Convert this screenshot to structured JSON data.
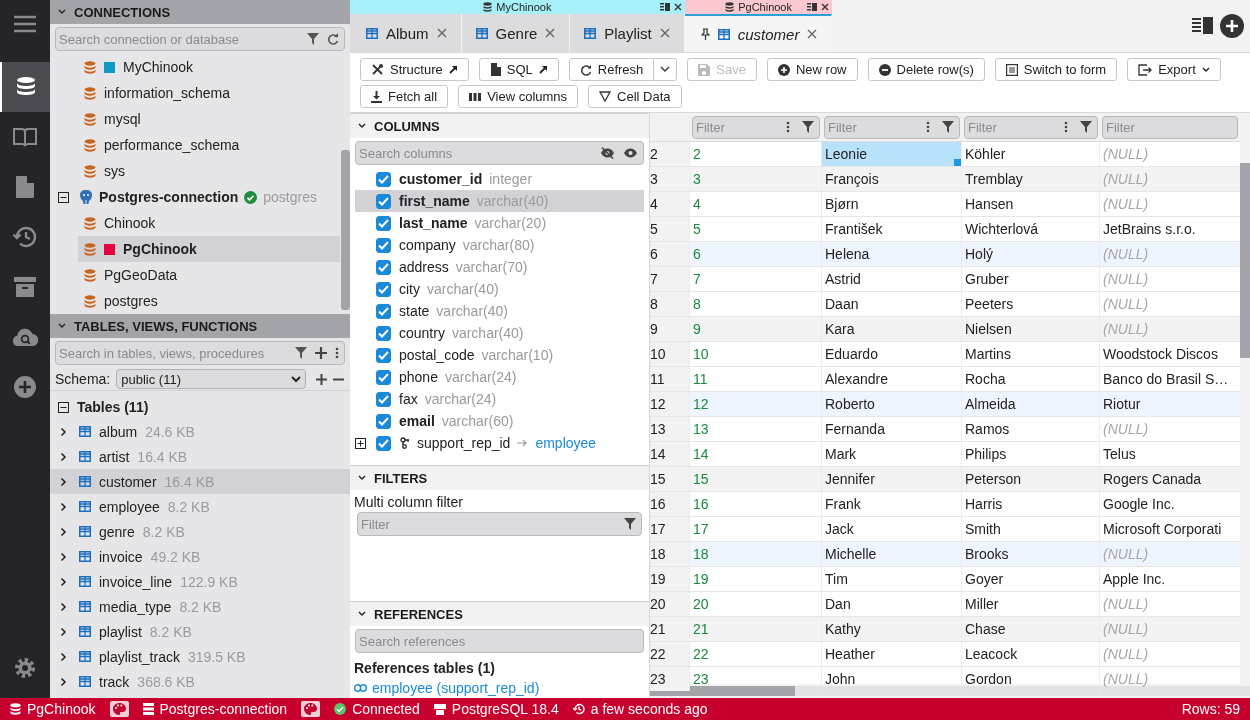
{
  "activity_bar": {
    "items": [
      {
        "selected": true
      },
      {
        "selected": false
      },
      {
        "selected": false
      },
      {
        "selected": false
      },
      {
        "selected": false
      },
      {
        "selected": false
      }
    ]
  },
  "connections": {
    "title": "CONNECTIONS",
    "search": {
      "placeholder": "Search connection or database"
    },
    "items": [
      {
        "kind": "database",
        "name": "MyChinook",
        "color": "#0e98c4",
        "selected": false
      },
      {
        "kind": "database",
        "name": "information_schema",
        "selected": false
      },
      {
        "kind": "database",
        "name": "mysql",
        "selected": false
      },
      {
        "kind": "database",
        "name": "performance_schema",
        "selected": false
      },
      {
        "kind": "database",
        "name": "sys",
        "selected": false
      },
      {
        "kind": "connection",
        "name": "Postgres-connection",
        "connected": true,
        "user": "postgres",
        "expanded": true,
        "children": [
          {
            "kind": "database",
            "name": "Chinook",
            "selected": false
          },
          {
            "kind": "database",
            "name": "PgChinook",
            "color": "#e8003d",
            "selected": true
          },
          {
            "kind": "database",
            "name": "PgGeoData",
            "selected": false
          },
          {
            "kind": "database",
            "name": "postgres",
            "selected": false
          }
        ]
      }
    ]
  },
  "tables_panel": {
    "title": "TABLES, VIEWS, FUNCTIONS",
    "search": {
      "placeholder": "Search in tables, views, procedures"
    },
    "schema_label": "Schema:",
    "schema": "public (11)",
    "group": {
      "label": "Tables (11)",
      "expanded": true,
      "items": [
        {
          "name": "album",
          "size": "24.6 KB",
          "selected": false
        },
        {
          "name": "artist",
          "size": "16.4 KB",
          "selected": false
        },
        {
          "name": "customer",
          "size": "16.4 KB",
          "selected": true
        },
        {
          "name": "employee",
          "size": "8.2 KB",
          "selected": false
        },
        {
          "name": "genre",
          "size": "8.2 KB",
          "selected": false
        },
        {
          "name": "invoice",
          "size": "49.2 KB",
          "selected": false
        },
        {
          "name": "invoice_line",
          "size": "122.9 KB",
          "selected": false
        },
        {
          "name": "media_type",
          "size": "8.2 KB",
          "selected": false
        },
        {
          "name": "playlist",
          "size": "8.2 KB",
          "selected": false
        },
        {
          "name": "playlist_track",
          "size": "319.5 KB",
          "selected": false
        },
        {
          "name": "track",
          "size": "368.6 KB",
          "selected": false
        }
      ]
    }
  },
  "tab_groups": [
    {
      "title": "MyChinook",
      "color": "#a6f0fa",
      "tabs": [
        {
          "label": "Album",
          "selected": false,
          "pinned": false
        },
        {
          "label": "Genre",
          "selected": false,
          "pinned": false
        },
        {
          "label": "Playlist",
          "selected": false,
          "pinned": false
        }
      ]
    },
    {
      "title": "PgChinook",
      "color": "#fcc8d0",
      "tabs": [
        {
          "label": "customer",
          "selected": true,
          "pinned": true
        }
      ]
    }
  ],
  "toolbar": {
    "rows": [
      [
        {
          "label": "Structure",
          "disabled": false,
          "external": true
        },
        {
          "label": "SQL",
          "disabled": false,
          "external": true
        },
        {
          "label": "Refresh",
          "disabled": false,
          "split": true
        },
        {
          "label": "Save",
          "disabled": true
        },
        {
          "label": "New row",
          "disabled": false
        },
        {
          "label": "Delete row(s)",
          "disabled": false
        },
        {
          "label": "Switch to form",
          "disabled": false
        },
        {
          "label": "Export",
          "disabled": false,
          "menu": true
        }
      ],
      [
        {
          "label": "Fetch all",
          "disabled": false
        },
        {
          "label": "View columns",
          "disabled": false
        },
        {
          "label": "Cell Data",
          "disabled": false
        }
      ]
    ]
  },
  "columns_panel": {
    "title": "COLUMNS",
    "search": {
      "placeholder": "Search columns"
    },
    "items": [
      {
        "name": "customer_id",
        "type": "integer",
        "checked": true,
        "emphasized": true,
        "selected": false
      },
      {
        "name": "first_name",
        "type": "varchar(40)",
        "checked": true,
        "emphasized": true,
        "selected": true
      },
      {
        "name": "last_name",
        "type": "varchar(20)",
        "checked": true,
        "emphasized": true,
        "selected": false
      },
      {
        "name": "company",
        "type": "varchar(80)",
        "checked": true,
        "emphasized": false,
        "selected": false
      },
      {
        "name": "address",
        "type": "varchar(70)",
        "checked": true,
        "emphasized": false,
        "selected": false
      },
      {
        "name": "city",
        "type": "varchar(40)",
        "checked": true,
        "emphasized": false,
        "selected": false
      },
      {
        "name": "state",
        "type": "varchar(40)",
        "checked": true,
        "emphasized": false,
        "selected": false
      },
      {
        "name": "country",
        "type": "varchar(40)",
        "checked": true,
        "emphasized": false,
        "selected": false
      },
      {
        "name": "postal_code",
        "type": "varchar(10)",
        "checked": true,
        "emphasized": false,
        "selected": false
      },
      {
        "name": "phone",
        "type": "varchar(24)",
        "checked": true,
        "emphasized": false,
        "selected": false
      },
      {
        "name": "fax",
        "type": "varchar(24)",
        "checked": true,
        "emphasized": false,
        "selected": false
      },
      {
        "name": "email",
        "type": "varchar(60)",
        "checked": true,
        "emphasized": true,
        "selected": false
      },
      {
        "name": "support_rep_id",
        "reference": "employee",
        "expanded": false,
        "checked": true,
        "emphasized": false,
        "selected": false
      }
    ]
  },
  "filters_panel": {
    "title": "FILTERS",
    "label": "Multi column filter",
    "filter": {
      "placeholder": "Filter"
    }
  },
  "references_panel": {
    "title": "REFERENCES",
    "search": {
      "placeholder": "Search references"
    },
    "heading": "References tables (1)",
    "links": [
      "employee (support_rep_id)"
    ]
  },
  "grid": {
    "filters": [
      {
        "placeholder": "Filter"
      },
      {
        "placeholder": "Filter"
      },
      {
        "placeholder": "Filter"
      },
      {
        "placeholder": "Filter"
      }
    ],
    "rows": [
      {
        "row": "2",
        "customer_id": "2",
        "first_name": "Leonie",
        "last_name": "Köhler",
        "company": "(NULL)",
        "company_null": true,
        "selected": true
      },
      {
        "row": "3",
        "customer_id": "3",
        "first_name": "François",
        "last_name": "Tremblay",
        "company": "(NULL)",
        "company_null": true,
        "selected": false
      },
      {
        "row": "4",
        "customer_id": "4",
        "first_name": "Bjørn",
        "last_name": "Hansen",
        "company": "(NULL)",
        "company_null": true,
        "selected": false
      },
      {
        "row": "5",
        "customer_id": "5",
        "first_name": "František",
        "last_name": "Wichterlová",
        "company": "JetBrains s.r.o.",
        "company_null": false,
        "selected": false
      },
      {
        "row": "6",
        "customer_id": "6",
        "first_name": "Helena",
        "last_name": "Holý",
        "company": "(NULL)",
        "company_null": true,
        "selected": false
      },
      {
        "row": "7",
        "customer_id": "7",
        "first_name": "Astrid",
        "last_name": "Gruber",
        "company": "(NULL)",
        "company_null": true,
        "selected": false
      },
      {
        "row": "8",
        "customer_id": "8",
        "first_name": "Daan",
        "last_name": "Peeters",
        "company": "(NULL)",
        "company_null": true,
        "selected": false
      },
      {
        "row": "9",
        "customer_id": "9",
        "first_name": "Kara",
        "last_name": "Nielsen",
        "company": "(NULL)",
        "company_null": true,
        "selected": false
      },
      {
        "row": "10",
        "customer_id": "10",
        "first_name": "Eduardo",
        "last_name": "Martins",
        "company": "Woodstock Discos",
        "company_null": false,
        "selected": false
      },
      {
        "row": "11",
        "customer_id": "11",
        "first_name": "Alexandre",
        "last_name": "Rocha",
        "company": "Banco do Brasil S…",
        "company_null": false,
        "selected": false
      },
      {
        "row": "12",
        "customer_id": "12",
        "first_name": "Roberto",
        "last_name": "Almeida",
        "company": "Riotur",
        "company_null": false,
        "selected": false
      },
      {
        "row": "13",
        "customer_id": "13",
        "first_name": "Fernanda",
        "last_name": "Ramos",
        "company": "(NULL)",
        "company_null": true,
        "selected": false
      },
      {
        "row": "14",
        "customer_id": "14",
        "first_name": "Mark",
        "last_name": "Philips",
        "company": "Telus",
        "company_null": false,
        "selected": false
      },
      {
        "row": "15",
        "customer_id": "15",
        "first_name": "Jennifer",
        "last_name": "Peterson",
        "company": "Rogers Canada",
        "company_null": false,
        "selected": false
      },
      {
        "row": "16",
        "customer_id": "16",
        "first_name": "Frank",
        "last_name": "Harris",
        "company": "Google Inc.",
        "company_null": false,
        "selected": false
      },
      {
        "row": "17",
        "customer_id": "17",
        "first_name": "Jack",
        "last_name": "Smith",
        "company": "Microsoft Corporati",
        "company_null": false,
        "selected": false
      },
      {
        "row": "18",
        "customer_id": "18",
        "first_name": "Michelle",
        "last_name": "Brooks",
        "company": "(NULL)",
        "company_null": true,
        "selected": false
      },
      {
        "row": "19",
        "customer_id": "19",
        "first_name": "Tim",
        "last_name": "Goyer",
        "company": "Apple Inc.",
        "company_null": false,
        "selected": false
      },
      {
        "row": "20",
        "customer_id": "20",
        "first_name": "Dan",
        "last_name": "Miller",
        "company": "(NULL)",
        "company_null": true,
        "selected": false
      },
      {
        "row": "21",
        "customer_id": "21",
        "first_name": "Kathy",
        "last_name": "Chase",
        "company": "(NULL)",
        "company_null": true,
        "selected": false
      },
      {
        "row": "22",
        "customer_id": "22",
        "first_name": "Heather",
        "last_name": "Leacock",
        "company": "(NULL)",
        "company_null": true,
        "selected": false
      },
      {
        "row": "23",
        "customer_id": "23",
        "first_name": "John",
        "last_name": "Gordon",
        "company": "(NULL)",
        "company_null": true,
        "selected": false
      }
    ]
  },
  "status_bar": {
    "items": [
      {
        "kind": "database",
        "label": "PgChinook"
      },
      {
        "kind": "palette"
      },
      {
        "kind": "connection",
        "label": "Postgres-connection"
      },
      {
        "kind": "palette"
      },
      {
        "kind": "connected",
        "label": "Connected"
      },
      {
        "kind": "server",
        "label": "PostgreSQL 18.4"
      },
      {
        "kind": "time",
        "label": "a few seconds ago"
      }
    ],
    "rows": "Rows: 59"
  }
}
